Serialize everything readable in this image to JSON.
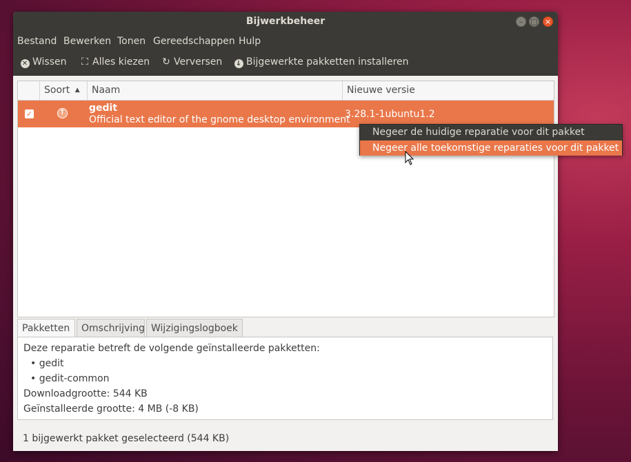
{
  "window": {
    "title": "Bijwerkbeheer"
  },
  "menu": [
    "Bestand",
    "Bewerken",
    "Tonen",
    "Gereedschappen",
    "Hulp"
  ],
  "toolbar": {
    "clear": "Wissen",
    "select_all": "Alles kiezen",
    "refresh": "Verversen",
    "install": "Bijgewerkte pakketten installeren"
  },
  "columns": {
    "type": "Soort",
    "name": "Naam",
    "new_version": "Nieuwe versie"
  },
  "packages": [
    {
      "name": "gedit",
      "description": "Official text editor of the gnome desktop environment",
      "version": "3.28.1-1ubuntu1.2",
      "checked": true
    }
  ],
  "context_menu": [
    "Negeer de huidige reparatie voor dit pakket",
    "Negeer alle toekomstige reparaties voor dit pakket"
  ],
  "tabs": [
    "Pakketten",
    "Omschrijving",
    "Wijzigingslogboek"
  ],
  "details": {
    "intro": "Deze reparatie betreft de volgende geïnstalleerde pakketten:",
    "items": [
      "gedit",
      "gedit-common"
    ],
    "download_size": "Downloadgrootte: 544 KB",
    "installed_size": "Geïnstalleerde grootte: 4 MB (-8 KB)"
  },
  "status": "1 bijgewerkt pakket geselecteerd (544 KB)",
  "colors": {
    "accent": "#e9774a",
    "titlebar": "#3b3a36"
  }
}
